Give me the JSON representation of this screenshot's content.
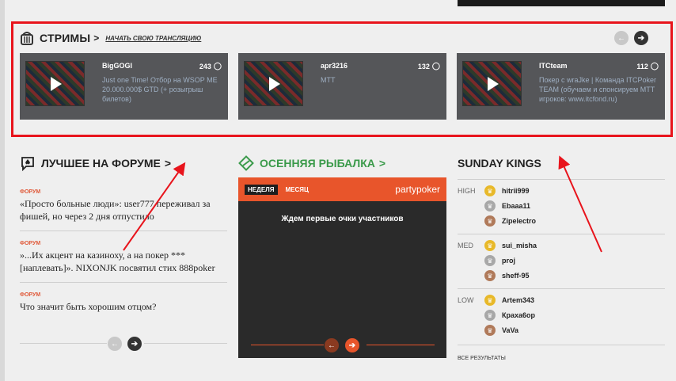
{
  "streams": {
    "title": "СТРИМЫ",
    "chevron": ">",
    "start_link": "НАЧАТЬ СВОЮ ТРАНСЛЯЦИЮ",
    "prev": "←",
    "next": "➔",
    "items": [
      {
        "user": "BigGOGI",
        "viewers": "243",
        "desc": "Just one Time! Отбор на WSOP ME 20.000.000$ GTD (+ розыгрыш билетов)"
      },
      {
        "user": "apr3216",
        "viewers": "132",
        "desc": "MTT"
      },
      {
        "user": "ITCteam",
        "viewers": "112",
        "desc": "Покер с wraJke | Команда ITCPoker TEAM (обучаем и спонсируем MTT игроков: www.itcfond.ru)"
      }
    ]
  },
  "forum": {
    "title": "ЛУЧШЕЕ НА ФОРУМЕ",
    "chevron": ">",
    "items": [
      {
        "tag": "ФОРУМ",
        "text": "«Просто больные люди»: user777 переживал за фишей, но через 2 дня отпустило"
      },
      {
        "tag": "ФОРУМ",
        "text": "»...Их акцент на казиноху, а на покер *** [наплевать]». NIXONJK посвятил стих 888poker"
      },
      {
        "tag": "ФОРУМ",
        "text": "Что значит быть хорошим отцом?"
      }
    ],
    "prev": "←",
    "next": "➔"
  },
  "fishing": {
    "title": "ОСЕННЯЯ РЫБАЛКА",
    "chevron": ">",
    "tab_week": "НЕДЕЛЯ",
    "tab_month": "МЕСЯЦ",
    "logo_left": "party",
    "logo_right": "poker",
    "message": "Ждем первые очки участников",
    "prev": "←",
    "next": "➔"
  },
  "kings": {
    "title": "SUNDAY KINGS",
    "groups": [
      {
        "label": "HIGH",
        "players": [
          "hitrii999",
          "Ebaaa11",
          "Zipelectro"
        ]
      },
      {
        "label": "MED",
        "players": [
          "sui_misha",
          "proj",
          "sheff-95"
        ]
      },
      {
        "label": "LOW",
        "players": [
          "Artem343",
          "Краха6ор",
          "VaVa"
        ]
      }
    ],
    "all_results": "ВСЕ РЕЗУЛЬТАТЫ"
  },
  "colors": {
    "highlight": "#e8141c",
    "accent_orange": "#e8552b",
    "accent_green": "#3a9a4a",
    "gold": "#e8b92a",
    "silver": "#a8a8a8",
    "bronze": "#b07a5a"
  }
}
